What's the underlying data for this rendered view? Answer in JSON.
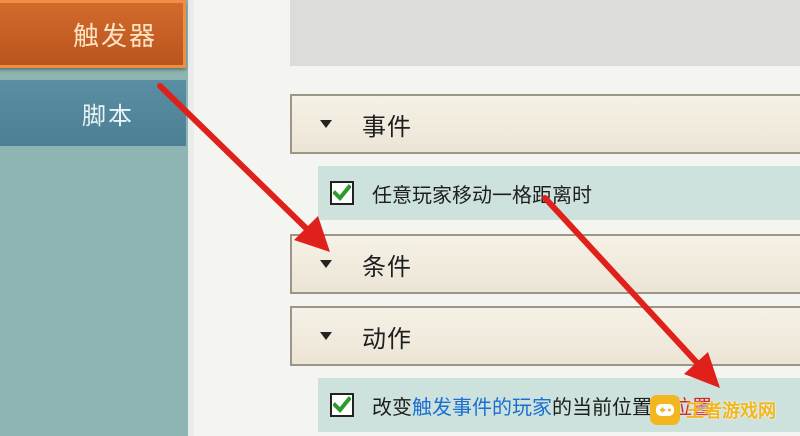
{
  "sidebar": {
    "tabs": [
      {
        "label": "触发器",
        "active": true
      },
      {
        "label": "脚本",
        "active": false
      }
    ]
  },
  "sections": {
    "event": {
      "title": "事件",
      "item": {
        "text": "任意玩家移动一格距离时",
        "checked": true
      }
    },
    "condition": {
      "title": "条件"
    },
    "action": {
      "title": "动作",
      "item": {
        "prefix": "改变",
        "highlight": "触发事件的玩家",
        "middle": "的当前位置到",
        "highlight2": "位置",
        "checked": true
      }
    }
  },
  "watermark": {
    "text": "王者游戏网",
    "icon": "gamepad-icon"
  },
  "colors": {
    "sidebar_bg": "#8fb5b2",
    "tab_active": "#c45f24",
    "tab_script": "#5288a0",
    "section_bg": "#f1ebdf",
    "item_bg": "#cde2dd",
    "checkbox_check": "#2e9a2e",
    "arrow": "#e0201a",
    "highlight_blue": "#1a6fd1",
    "highlight_red": "#d8261e"
  }
}
